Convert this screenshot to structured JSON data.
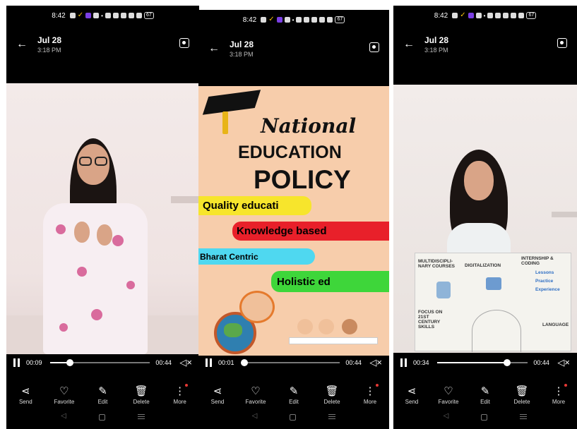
{
  "screens": [
    {
      "status": {
        "time": "8:42",
        "battery": "67"
      },
      "header": {
        "date": "Jul 28",
        "time": "3:18 PM"
      },
      "player": {
        "current": "00:09",
        "duration": "00:44",
        "progress": 0.2
      },
      "actions": [
        {
          "label": "Send",
          "icon": "share-icon"
        },
        {
          "label": "Favorite",
          "icon": "heart-icon"
        },
        {
          "label": "Edit",
          "icon": "pencil-icon"
        },
        {
          "label": "Delete",
          "icon": "trash-icon"
        },
        {
          "label": "More",
          "icon": "more-vertical-icon"
        }
      ]
    },
    {
      "status": {
        "time": "8:42",
        "battery": "67"
      },
      "header": {
        "date": "Jul 28",
        "time": "3:18 PM"
      },
      "player": {
        "current": "00:01",
        "duration": "00:44",
        "progress": 0.02
      },
      "slide": {
        "national": "National",
        "education": "EDUCATION",
        "policy": "POLICY",
        "items": [
          {
            "text": "Quality educati",
            "color": "#f7e52c"
          },
          {
            "text": "Knowledge based",
            "color": "#e8202a"
          },
          {
            "text": "Bharat Centric",
            "color": "#4fd8f0"
          },
          {
            "text": "Holistic ed",
            "color": "#3ed63a"
          }
        ]
      },
      "actions": [
        {
          "label": "Send",
          "icon": "share-icon"
        },
        {
          "label": "Favorite",
          "icon": "heart-icon"
        },
        {
          "label": "Edit",
          "icon": "pencil-icon"
        },
        {
          "label": "Delete",
          "icon": "trash-icon"
        },
        {
          "label": "More",
          "icon": "more-vertical-icon"
        }
      ]
    },
    {
      "status": {
        "time": "8:42",
        "battery": "67"
      },
      "header": {
        "date": "Jul 28",
        "time": "3:18 PM"
      },
      "player": {
        "current": "00:34",
        "duration": "00:44",
        "progress": 0.77
      },
      "board": {
        "multi": "MULTIDISCIPLI-NARY COURSES",
        "digital": "DIGITALIZATION",
        "intern": "INTERNSHIP & CODING",
        "lessons": "Lessons",
        "practice": "Practice",
        "experience": "Experience",
        "focus": "FOCUS ON 21ST CENTURY SKILLS",
        "language": "LANGUAGE"
      },
      "actions": [
        {
          "label": "Send",
          "icon": "share-icon"
        },
        {
          "label": "Favorite",
          "icon": "heart-icon"
        },
        {
          "label": "Edit",
          "icon": "pencil-icon"
        },
        {
          "label": "Delete",
          "icon": "trash-icon"
        },
        {
          "label": "More",
          "icon": "more-vertical-icon"
        }
      ]
    }
  ]
}
